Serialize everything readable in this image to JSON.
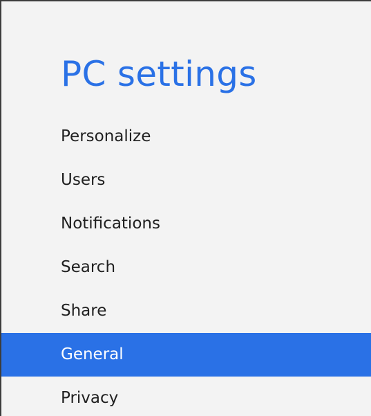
{
  "header": {
    "title": "PC settings"
  },
  "colors": {
    "accent": "#2a71e6",
    "background": "#f3f3f3",
    "text": "#202020",
    "selected_text": "#ffffff"
  },
  "nav": {
    "items": [
      {
        "label": "Personalize",
        "selected": false
      },
      {
        "label": "Users",
        "selected": false
      },
      {
        "label": "Notifications",
        "selected": false
      },
      {
        "label": "Search",
        "selected": false
      },
      {
        "label": "Share",
        "selected": false
      },
      {
        "label": "General",
        "selected": true
      },
      {
        "label": "Privacy",
        "selected": false
      }
    ]
  }
}
